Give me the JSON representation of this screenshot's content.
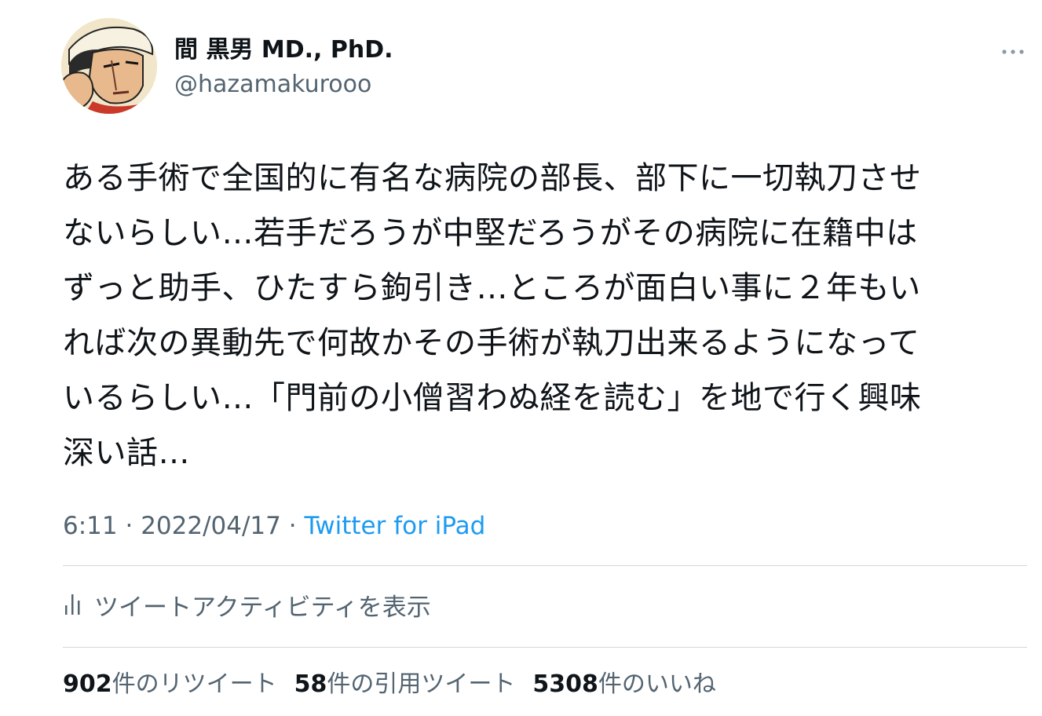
{
  "author": {
    "display_name": "間 黒男 MD., PhD.",
    "handle": "@hazamakurooo"
  },
  "tweet": {
    "lines": [
      "ある手術で全国的に有名な病院の部長、部下に一切執刀させ",
      "ないらしい…若手だろうが中堅だろうがその病院に在籍中は",
      "ずっと助手、ひたすら鉤引き…ところが面白い事に２年もい",
      "れば次の異動先で何故かその手術が執刀出来るようになって",
      "いるらしい…「門前の小僧習わぬ経を読む」を地で行く興味",
      "深い話…"
    ],
    "time": "6:11",
    "date": "2022/04/17",
    "separator": "·",
    "source": "Twitter for iPad"
  },
  "activity": {
    "label": "ツイートアクティビティを表示",
    "icon": "bar-chart-icon"
  },
  "stats": {
    "retweets": {
      "count": "902",
      "label": "件のリツイート"
    },
    "quotes": {
      "count": "58",
      "label": "件の引用ツイート"
    },
    "likes": {
      "count": "5308",
      "label": "件のいいね"
    }
  },
  "menu": {
    "icon": "more-icon"
  },
  "colors": {
    "text": "#0f1419",
    "secondary": "#536471",
    "link": "#1d9bf0",
    "divider": "#cfd9de"
  }
}
